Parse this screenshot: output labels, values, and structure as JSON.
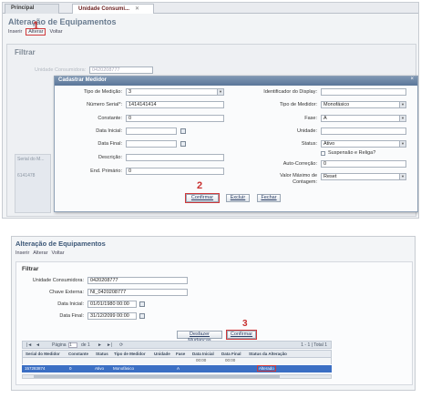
{
  "step1": {
    "tabs": [
      {
        "label": "Principal"
      },
      {
        "label": "Unidade Consumi...",
        "close": "✕"
      }
    ],
    "page_title": "Alteração de Equipamentos",
    "menu": {
      "insert": "Inserir",
      "alter": "Alterar",
      "back": "Voltar"
    },
    "filter_label": "Filtrar",
    "bg_consumer_label": "Unidade Consumidora:",
    "bg_consumer_value": "0420208777",
    "bg_grid_header": "Serial do M...",
    "bg_grid_value": "6141478",
    "step_number": "1",
    "dialog": {
      "title": "Cadastrar Medidor",
      "close": "×",
      "left_fields": {
        "tipo_medicao": {
          "label": "Tipo de Medição:",
          "value": "3"
        },
        "numero_serial": {
          "label": "Número Serial*:",
          "value": "1414141414"
        },
        "constante": {
          "label": "Constante:",
          "value": "0"
        },
        "data_inicial": {
          "label": "Data Inicial:",
          "value": ""
        },
        "data_final": {
          "label": "Data Final:",
          "value": ""
        },
        "descricao": {
          "label": "Descrição:",
          "value": ""
        },
        "end_primario": {
          "label": "End. Primário:",
          "value": "0"
        }
      },
      "right_fields": {
        "identificador_display": {
          "label": "Identificador do Display:",
          "value": ""
        },
        "tipo_medidor": {
          "label": "Tipo de Medidor:",
          "value": "Monofásico"
        },
        "fase": {
          "label": "Fase:",
          "value": "A"
        },
        "unidade": {
          "label": "Unidade:",
          "value": ""
        },
        "status": {
          "label": "Status:",
          "value": "Ativo"
        },
        "suspensao": {
          "label": "Suspensão e Religa?"
        },
        "auto_correcao": {
          "label": "Auto-Correção:",
          "value": "0"
        },
        "valor_maximo": {
          "label": "Valor Máximo de Contagem:",
          "value": "Reset"
        }
      },
      "buttons": {
        "confirm": "Confirmar",
        "delete": "Excluir",
        "close": "Fechar"
      },
      "step_number": "2"
    }
  },
  "step2": {
    "page_title": "Alteração de Equipamentos",
    "menu": {
      "insert": "Inserir",
      "alter": "Alterar",
      "back": "Voltar"
    },
    "filter_label": "Filtrar",
    "fields": {
      "unidade": {
        "label": "Unidade Consumidora:",
        "value": "0420208777"
      },
      "chave": {
        "label": "Chave Externa:",
        "value": "NI_0420208777"
      },
      "data_inicial": {
        "label": "Data Inicial:",
        "value": "01/01/1980 00:00"
      },
      "data_final": {
        "label": "Data Final:",
        "value": "31/12/2099 00:00"
      }
    },
    "buttons": {
      "undo": "Desfazer Mudanças",
      "confirm": "Confirmar"
    },
    "step_number": "3",
    "pager": {
      "page_label": "Página",
      "page_value": "1",
      "of": "de 1",
      "range": "1 - 1 | Total 1"
    },
    "columns": [
      "Serial do Medidor",
      "Constante",
      "Status",
      "Tipo de Medidor",
      "Unidade",
      "Fase",
      "Data Inicial",
      "Data Final",
      "Status da Alteração"
    ],
    "subrow": {
      "data_inicial": "00:00",
      "data_final": "00:00"
    },
    "row": {
      "serial": "157283874",
      "constante": "0",
      "status": "Ativo",
      "tipo": "Monofásico",
      "unidade": "",
      "fase": "A",
      "data_inicial": "",
      "data_final": "",
      "status_alteracao": "Alterado"
    }
  },
  "colors": {
    "highlight": "#d0393b",
    "dialog_header": "#6b84a6",
    "selected_row": "#3b6fc4",
    "title": "#3d5878"
  }
}
